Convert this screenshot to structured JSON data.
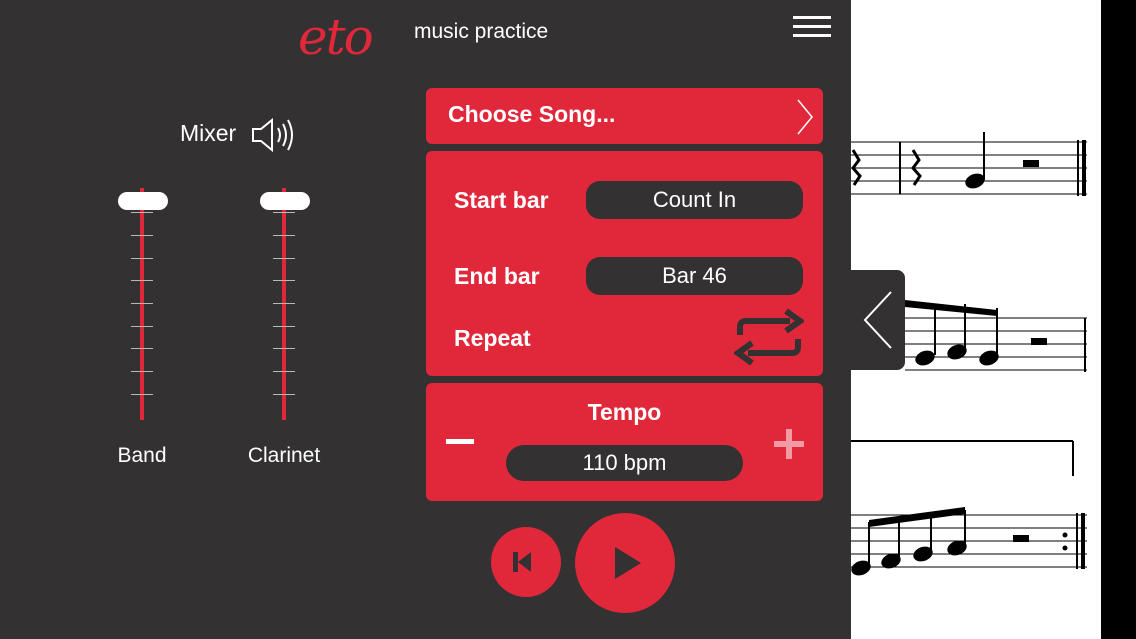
{
  "header": {
    "logo": "eto",
    "tagline": "music practice"
  },
  "mixer": {
    "title": "Mixer",
    "channels": [
      {
        "label": "Band"
      },
      {
        "label": "Clarinet"
      }
    ]
  },
  "song": {
    "label": "Choose Song..."
  },
  "range": {
    "start_label": "Start bar",
    "start_value": "Count In",
    "end_label": "End bar",
    "end_value": "Bar 46",
    "repeat_label": "Repeat"
  },
  "tempo": {
    "label": "Tempo",
    "value": "110 bpm"
  },
  "icons": {
    "menu": "hamburger-menu-icon",
    "speaker": "speaker-icon",
    "chevron": "chevron-right-icon",
    "repeat": "repeat-icon",
    "minus": "minus-icon",
    "plus": "plus-icon",
    "rewind": "skip-to-start-icon",
    "play": "play-icon",
    "handle": "chevron-left-icon"
  },
  "colors": {
    "accent": "#e0283a",
    "panel": "#333132",
    "sheet": "#ffffff"
  }
}
